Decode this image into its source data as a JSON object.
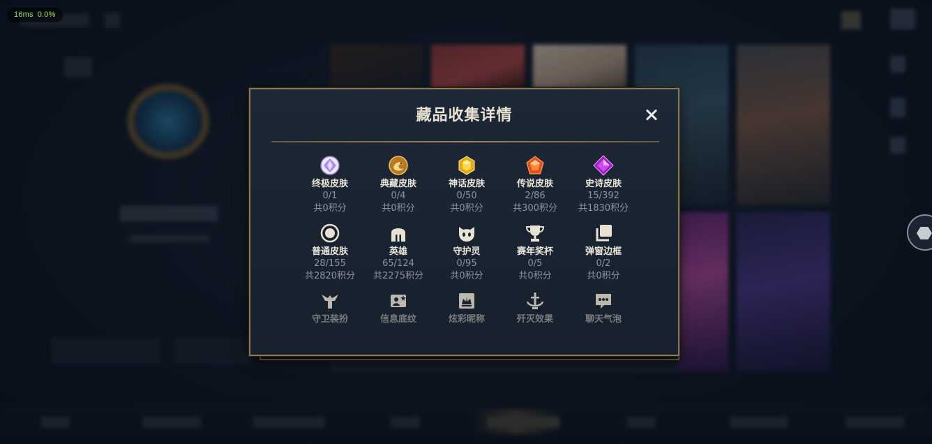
{
  "overlay": {
    "fps_ms": "16ms",
    "fps_pct": "0.0%"
  },
  "dialog": {
    "title": "藏品收集详情",
    "close_label": "✕",
    "items": [
      {
        "name": "终极皮肤",
        "count": "0/1",
        "points": "共0积分",
        "icon": "ultimate-skin-gem-icon",
        "color": "#c9b8ff"
      },
      {
        "name": "典藏皮肤",
        "count": "0/4",
        "points": "共0积分",
        "icon": "collection-skin-dragon-icon",
        "color": "#d9a040"
      },
      {
        "name": "神话皮肤",
        "count": "0/50",
        "points": "共0积分",
        "icon": "mythic-skin-gem-icon",
        "color": "#f0c020"
      },
      {
        "name": "传说皮肤",
        "count": "2/86",
        "points": "共300积分",
        "icon": "legendary-skin-gem-icon",
        "color": "#ff6a1a"
      },
      {
        "name": "史诗皮肤",
        "count": "15/392",
        "points": "共1830积分",
        "icon": "epic-skin-gem-icon",
        "color": "#c040e0"
      },
      {
        "name": "普通皮肤",
        "count": "28/155",
        "points": "共2820积分",
        "icon": "normal-skin-ring-icon",
        "color": "#e8e2d2"
      },
      {
        "name": "英雄",
        "count": "65/124",
        "points": "共2275积分",
        "icon": "champion-helmet-icon",
        "color": "#e8e2d2"
      },
      {
        "name": "守护灵",
        "count": "0/95",
        "points": "共0积分",
        "icon": "guardian-spirit-icon",
        "color": "#e8e2d2"
      },
      {
        "name": "赛年奖杯",
        "count": "0/5",
        "points": "共0积分",
        "icon": "season-trophy-icon",
        "color": "#e8e2d2"
      },
      {
        "name": "弹窗边框",
        "count": "0/2",
        "points": "共0积分",
        "icon": "popup-frame-icon",
        "color": "#e8e2d2"
      }
    ],
    "items_row3": [
      {
        "name": "守卫装扮",
        "icon": "ward-skin-icon"
      },
      {
        "name": "信息底纹",
        "icon": "info-pattern-icon"
      },
      {
        "name": "炫彩昵称",
        "icon": "colorful-nickname-icon"
      },
      {
        "name": "歼灭效果",
        "icon": "annihilation-effect-icon"
      },
      {
        "name": "聊天气泡",
        "icon": "chat-bubble-icon"
      }
    ]
  }
}
